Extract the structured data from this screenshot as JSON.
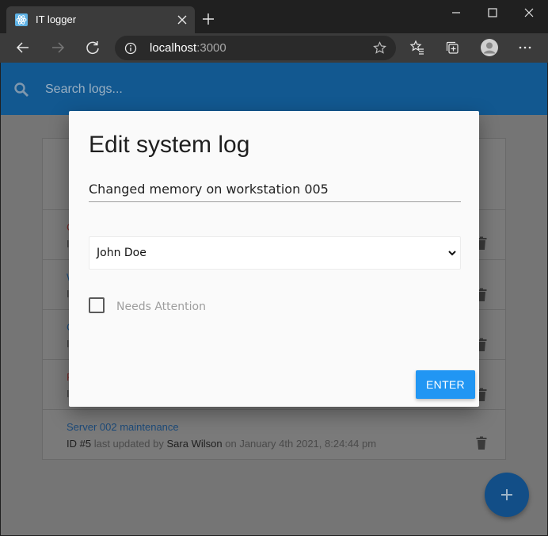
{
  "browser": {
    "tab_title": "IT logger",
    "address_host": "localhost",
    "address_port": ":3000"
  },
  "app": {
    "search_placeholder": "Search logs...",
    "logs": [
      {
        "title": "",
        "title_color": "#555555",
        "id": "",
        "updated_by_label": "",
        "tech": "",
        "on_label": "",
        "date": ""
      },
      {
        "title": "C",
        "title_color": "#7a2a2a",
        "id": "I",
        "updated_by_label": "",
        "tech": "",
        "on_label": "",
        "date": ""
      },
      {
        "title": "W",
        "title_color": "#1d4f80",
        "id": "I",
        "updated_by_label": "",
        "tech": "",
        "on_label": "",
        "date": ""
      },
      {
        "title": "C",
        "title_color": "#1d4f80",
        "id": "I",
        "updated_by_label": "",
        "tech": "",
        "on_label": "",
        "date": ""
      },
      {
        "title": "P",
        "title_color": "#7a2a2a",
        "id": "I",
        "updated_by_label": "",
        "tech": "",
        "on_label": "",
        "date": ""
      },
      {
        "title": "Server 002 maintenance",
        "title_color": "#1c4a79",
        "id": "ID #5",
        "updated_by_label": "last updated by",
        "tech": "Sara Wilson",
        "on_label": "on",
        "date": "January 4th 2021, 8:24:44 pm"
      }
    ]
  },
  "modal": {
    "title": "Edit system log",
    "message_value": "Changed memory on workstation 005",
    "tech_value": "John Doe",
    "attention_label": "Needs Attention",
    "attention_checked": false,
    "enter_label": "ENTER"
  },
  "icons": {
    "favicon": "react-atom-icon",
    "back": "arrow-left-icon",
    "forward": "arrow-right-icon",
    "refresh": "refresh-icon",
    "info": "info-icon",
    "favorite": "star-icon",
    "collections": "collections-icon",
    "profile": "avatar-icon",
    "menu": "more-horizontal-icon",
    "search": "search-icon",
    "delete": "trash-icon",
    "add": "plus-icon"
  },
  "colors": {
    "accent": "#2196f3",
    "app_bar": "#125890",
    "fab": "#124e87"
  }
}
